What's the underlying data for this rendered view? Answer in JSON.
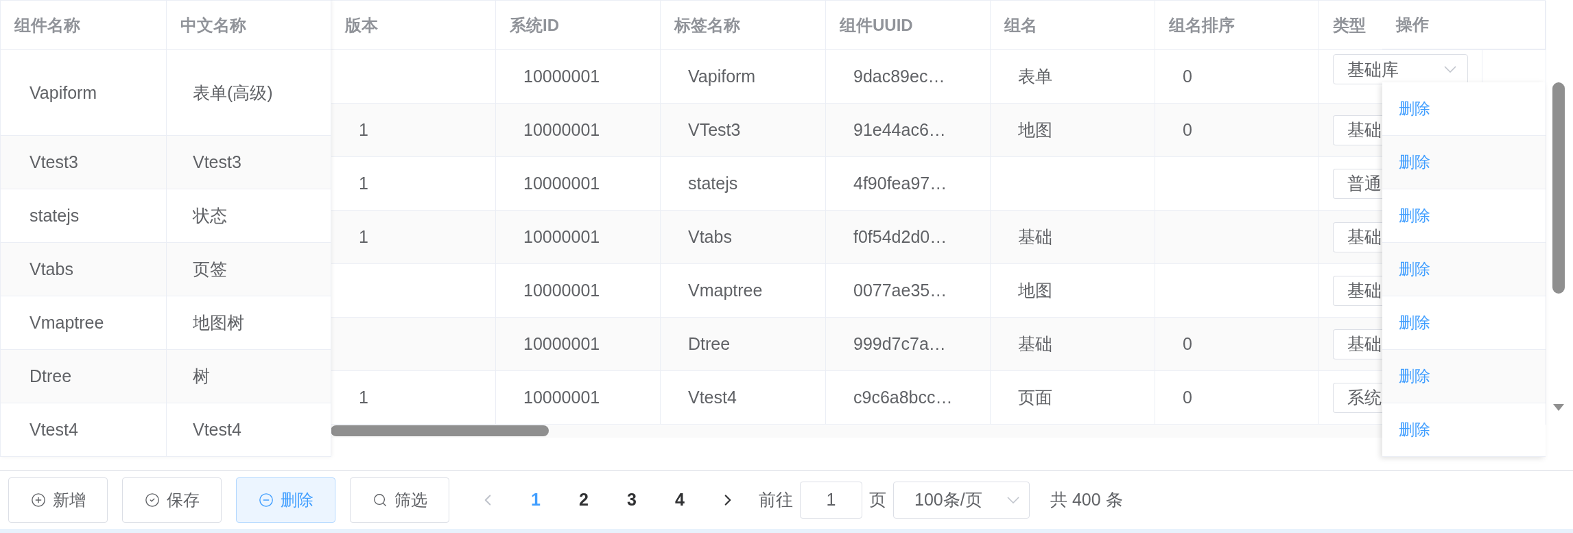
{
  "table": {
    "fixed_left": {
      "columns": [
        "组件名称",
        "中文名称"
      ],
      "rows": [
        {
          "name": "Vapiform",
          "cn_name": "表单(高级)"
        },
        {
          "name": "Vtest3",
          "cn_name": "Vtest3"
        },
        {
          "name": "statejs",
          "cn_name": "状态"
        },
        {
          "name": "Vtabs",
          "cn_name": "页签"
        },
        {
          "name": "Vmaptree",
          "cn_name": "地图树"
        },
        {
          "name": "Dtree",
          "cn_name": "树"
        },
        {
          "name": "Vtest4",
          "cn_name": "Vtest4"
        }
      ]
    },
    "main": {
      "columns": [
        "版本",
        "系统ID",
        "标签名称",
        "组件UUID",
        "组名",
        "组名排序",
        "类型"
      ],
      "rows": [
        {
          "system_id": "10000001",
          "tag": "Vapiform",
          "uuid": "9dac89ec…",
          "group": "表单",
          "group_order": "0",
          "type": "基础库"
        },
        {
          "version": "1",
          "system_id": "10000001",
          "tag": "VTest3",
          "uuid": "91e44ac6…",
          "group": "地图",
          "group_order": "0",
          "type": "基础"
        },
        {
          "version": "1",
          "system_id": "10000001",
          "tag": "statejs",
          "uuid": "4f90fea97…",
          "type": "普通"
        },
        {
          "version": "1",
          "system_id": "10000001",
          "tag": "Vtabs",
          "uuid": "f0f54d2d0…",
          "group": "基础",
          "type": "基础"
        },
        {
          "system_id": "10000001",
          "tag": "Vmaptree",
          "uuid": "0077ae35…",
          "group": "地图",
          "type": "基础"
        },
        {
          "system_id": "10000001",
          "tag": "Dtree",
          "uuid": "999d7c7a…",
          "group": "基础",
          "group_order": "0",
          "type": "基础"
        },
        {
          "version": "1",
          "system_id": "10000001",
          "tag": "Vtest4",
          "uuid": "c9c6a8bcc…",
          "group": "页面",
          "group_order": "0",
          "type": "系统"
        }
      ]
    },
    "fixed_right": {
      "column": "操作",
      "rows": [
        "删除",
        "删除",
        "删除",
        "删除",
        "删除",
        "删除",
        "删除"
      ]
    }
  },
  "footer": {
    "buttons": [
      {
        "kind": "add",
        "label": "新增",
        "highlighted": false
      },
      {
        "kind": "save",
        "label": "保存",
        "highlighted": false
      },
      {
        "kind": "delete",
        "label": "删除",
        "highlighted": true
      },
      {
        "kind": "filter",
        "label": "筛选",
        "highlighted": false
      }
    ],
    "pagination": {
      "prev": {
        "disabled": true
      },
      "pages": [
        {
          "label": "1",
          "selected": true
        },
        {
          "label": "2",
          "selected": false
        },
        {
          "label": "3",
          "selected": false
        },
        {
          "label": "4",
          "selected": false
        }
      ],
      "next": {
        "disabled": false
      },
      "goto_label": "前往",
      "goto_value": "1",
      "page_unit": "页",
      "page_size": "100条/页",
      "total": "共 400 条"
    }
  }
}
